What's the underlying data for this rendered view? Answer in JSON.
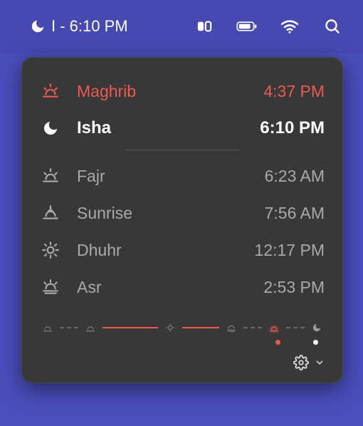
{
  "menubar": {
    "status_text": "I - 6:10 PM"
  },
  "colors": {
    "accent": "#ea5a50",
    "panel_bg": "#383838",
    "bg": "#4a4ebc"
  },
  "prayers": {
    "previous": {
      "name": "Maghrib",
      "time": "4:37 PM"
    },
    "current": {
      "name": "Isha",
      "time": "6:10 PM"
    },
    "list": [
      {
        "name": "Fajr",
        "time": "6:23 AM"
      },
      {
        "name": "Sunrise",
        "time": "7:56 AM"
      },
      {
        "name": "Dhuhr",
        "time": "12:17 PM"
      },
      {
        "name": "Asr",
        "time": "2:53 PM"
      }
    ]
  },
  "timeline": {
    "active_index": 5,
    "stops": [
      "fajr",
      "sunrise",
      "dhuhr",
      "asr",
      "maghrib",
      "isha"
    ]
  }
}
